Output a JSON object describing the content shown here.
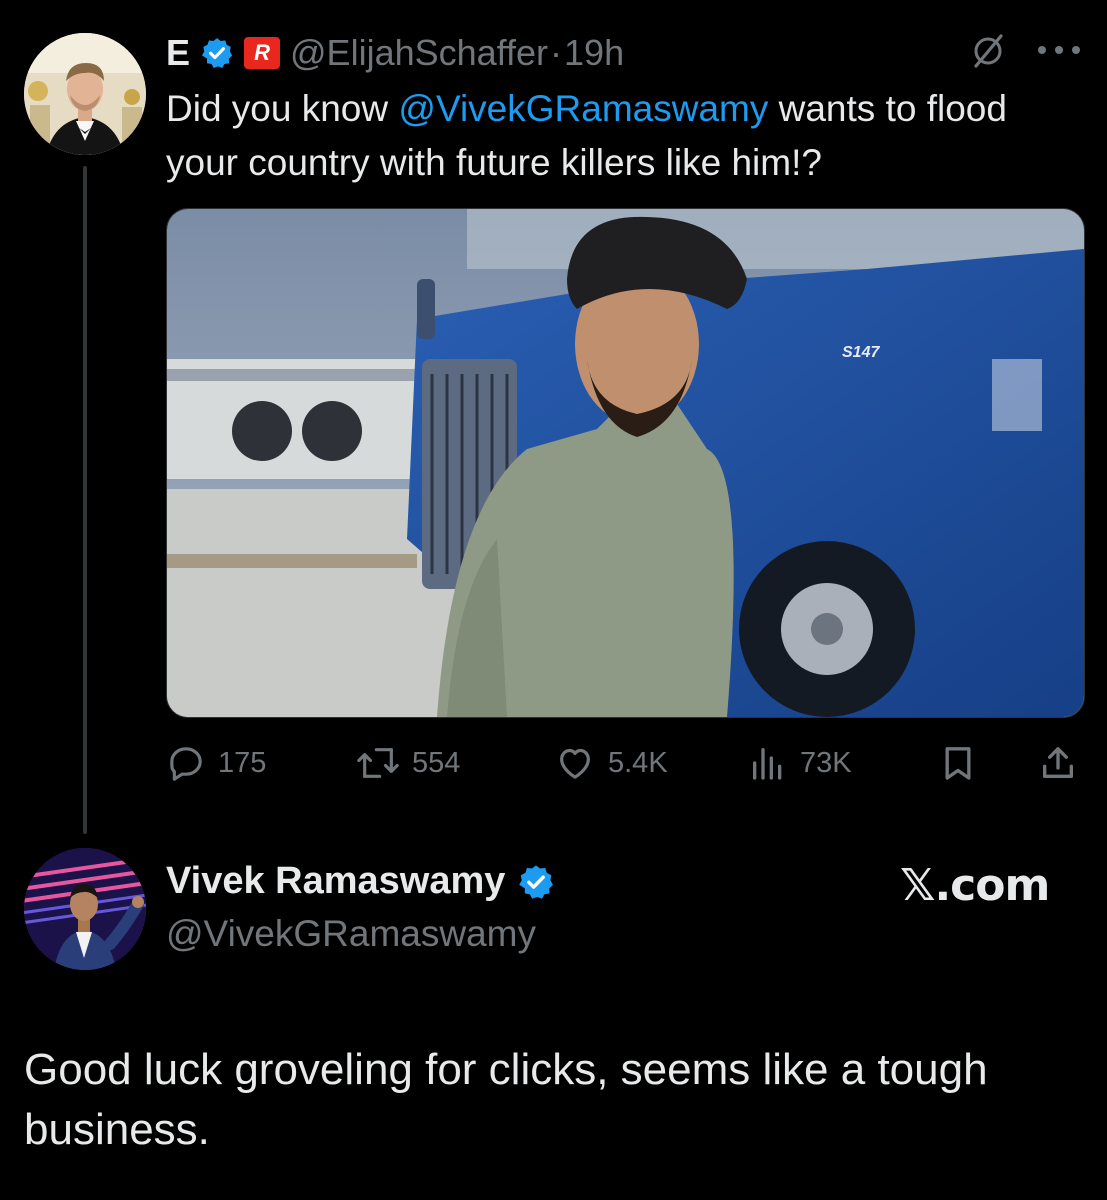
{
  "tweet": {
    "author_name": "E",
    "author_handle": "@ElijahSchaffer",
    "separator": "·",
    "time": "19h",
    "affiliate_badge": "R",
    "text_before": "Did you know ",
    "mention": "@VivekGRamaswamy",
    "text_after": " wants to flood your country with future killers like him!?",
    "media_label": "S147",
    "stats": {
      "replies": "175",
      "reposts": "554",
      "likes": "5.4K",
      "views": "73K"
    },
    "icons": [
      "verified-badge-icon",
      "grok-slash-icon",
      "more-icon",
      "reply-icon",
      "repost-icon",
      "like-icon",
      "views-icon",
      "bookmark-icon",
      "share-icon"
    ]
  },
  "reply_card": {
    "name": "Vivek Ramaswamy",
    "handle": "@VivekGRamaswamy",
    "brand": "𝕏.com",
    "text": "Good luck groveling for clicks, seems like a tough business."
  },
  "colors": {
    "background": "#000000",
    "text": "#e7e9ea",
    "muted": "#71767b",
    "accent": "#1d9bf0"
  }
}
